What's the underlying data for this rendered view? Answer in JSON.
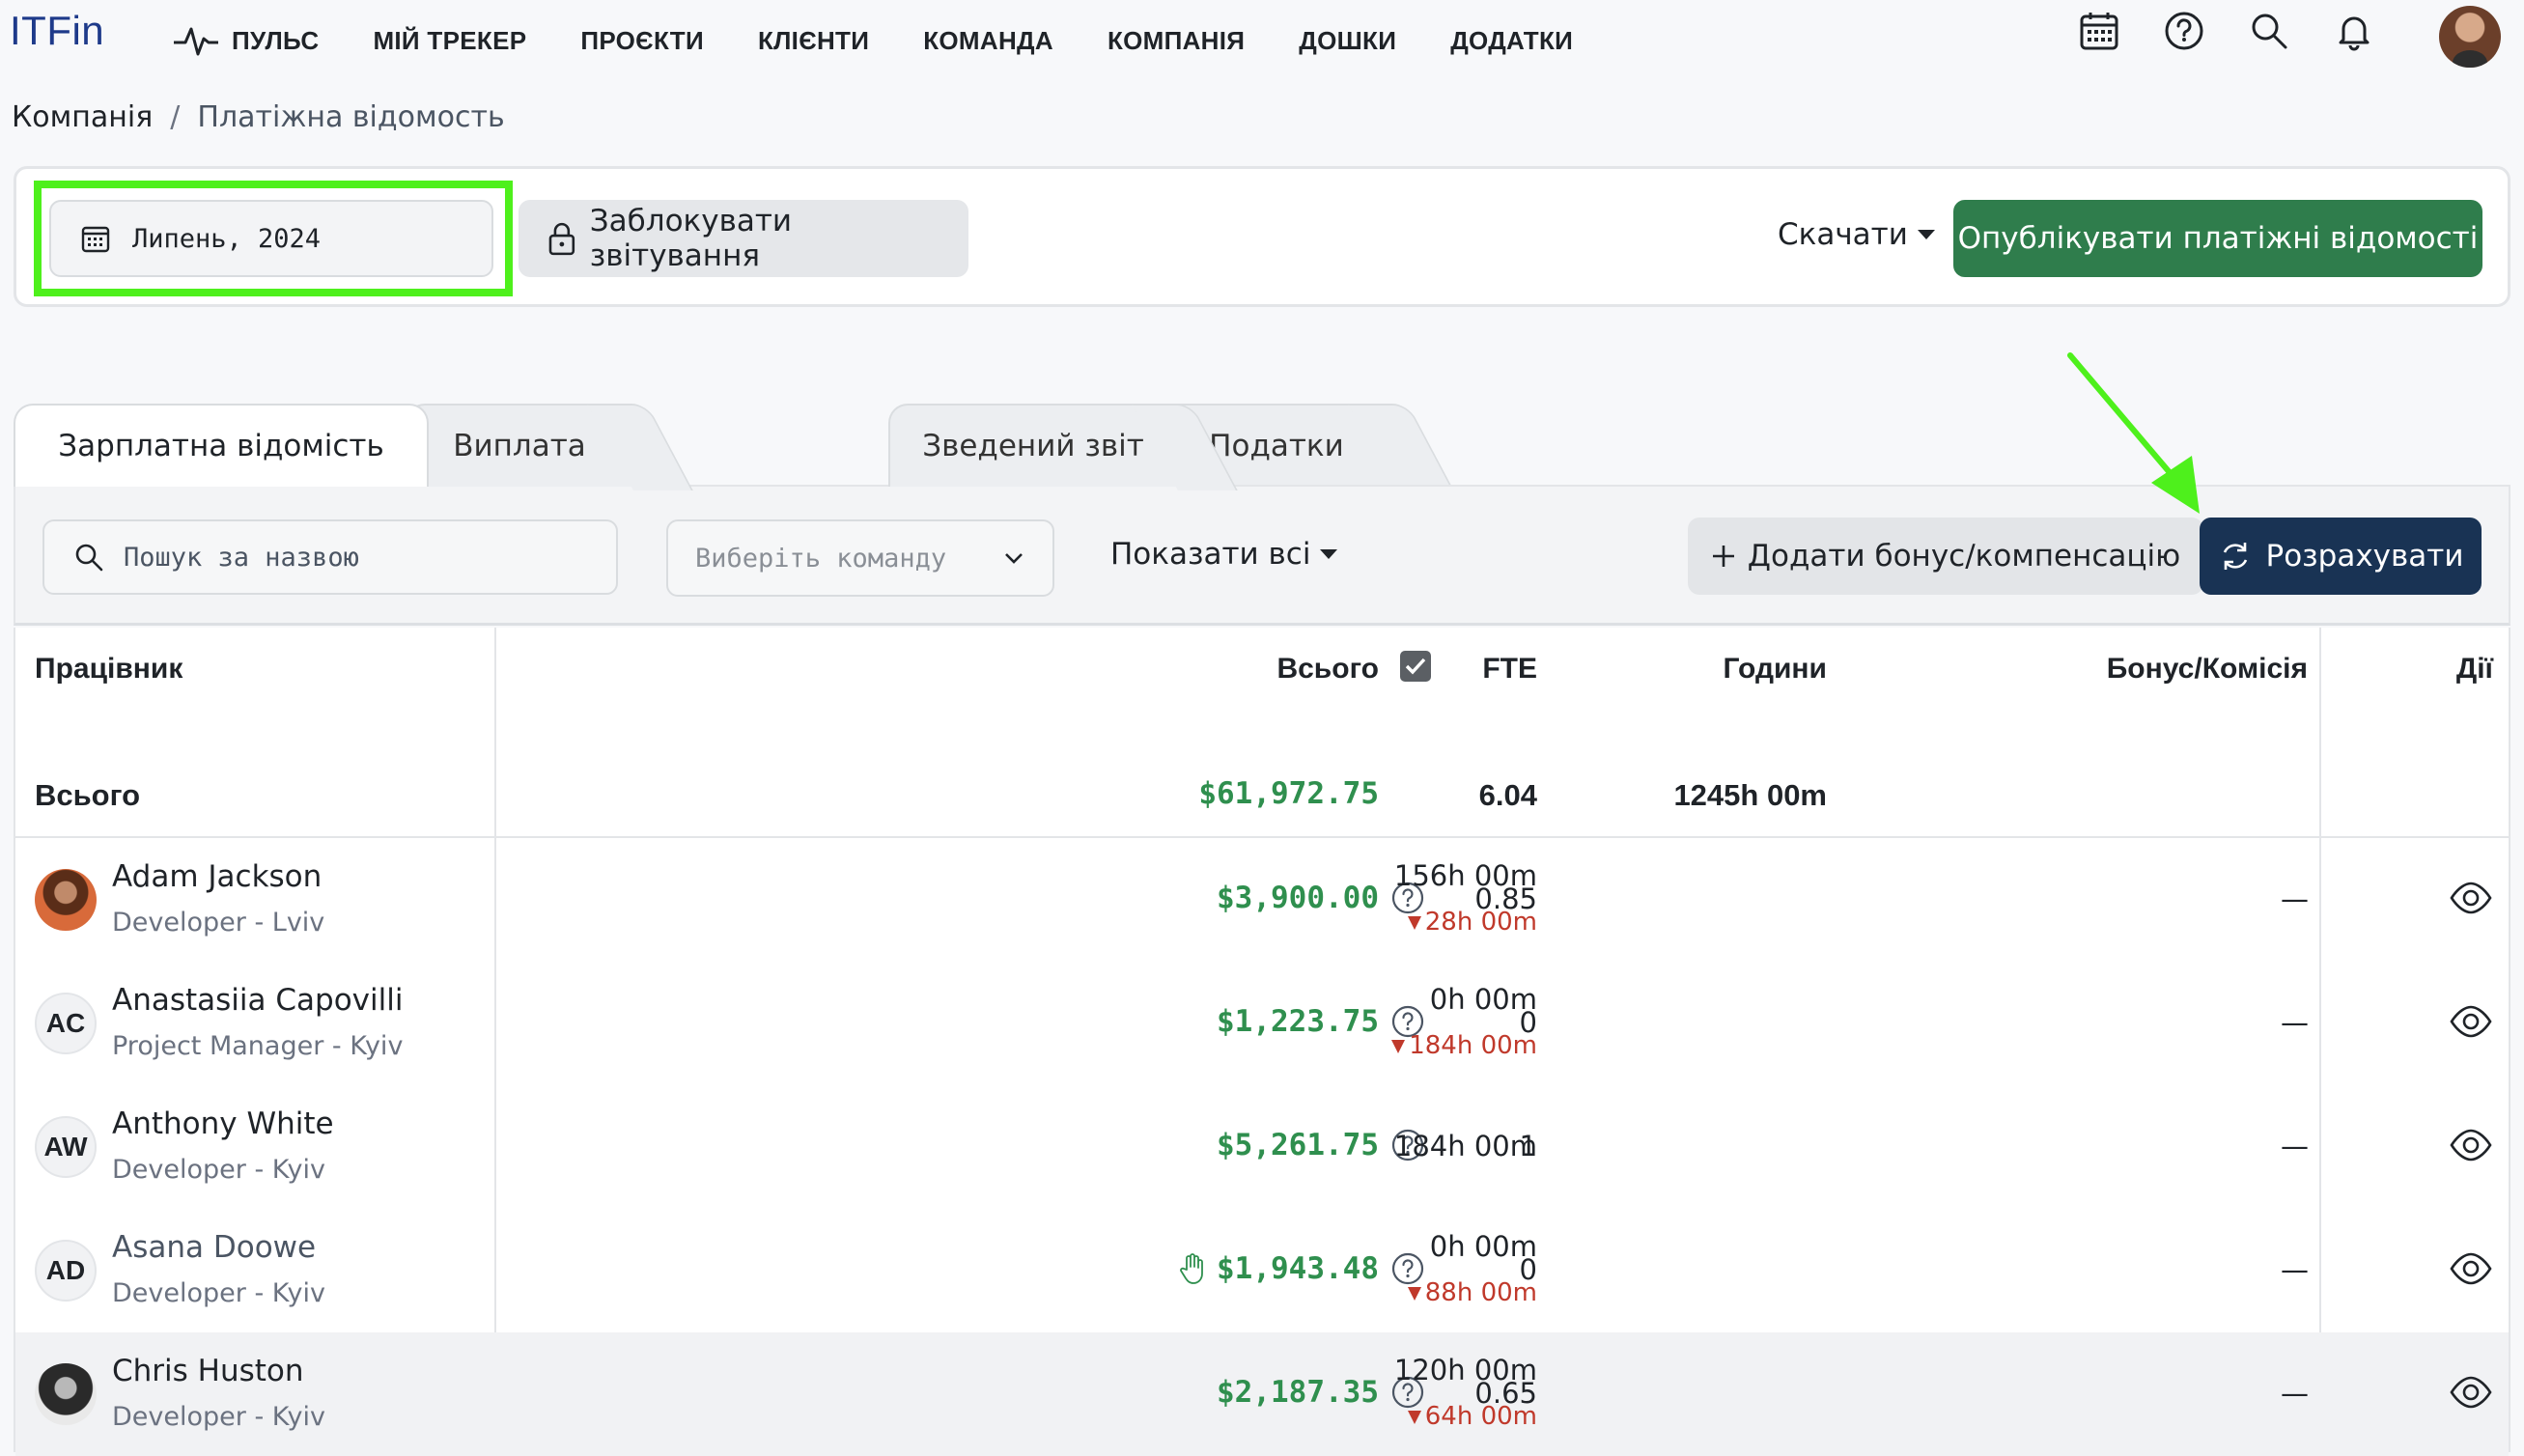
{
  "app": {
    "logo": "ITFin"
  },
  "nav": {
    "items": [
      {
        "label": "ПУЛЬС"
      },
      {
        "label": "МІЙ ТРЕКЕР"
      },
      {
        "label": "ПРОЄКТИ"
      },
      {
        "label": "КЛІЄНТИ"
      },
      {
        "label": "КОМАНДА"
      },
      {
        "label": "КОМПАНІЯ"
      },
      {
        "label": "ДОШКИ"
      },
      {
        "label": "ДОДАТКИ"
      }
    ],
    "icons": [
      "calendar-icon",
      "help-icon",
      "search-icon",
      "bell-icon",
      "user-avatar"
    ]
  },
  "breadcrumb": {
    "parent": "Компанія",
    "separator": "/",
    "current": "Платіжна відомость"
  },
  "toolbar": {
    "period": "Липень, 2024",
    "lock_label": "Заблокувати звітування",
    "download_label": "Скачати",
    "publish_label": "Опублікувати платіжні відомості"
  },
  "tabs": [
    {
      "label": "Зарплатна відомість",
      "active": true
    },
    {
      "label": "Виплата",
      "active": false
    },
    {
      "label": "Зведений звіт",
      "active": false
    },
    {
      "label": "Податки",
      "active": false
    }
  ],
  "filters": {
    "search_placeholder": "Пошук за назвою",
    "team_placeholder": "Виберіть команду",
    "show_all_label": "Показати всі",
    "add_bonus_label": "Додати бонус/компенсацію",
    "calculate_label": "Розрахувати"
  },
  "table": {
    "headers": {
      "employee": "Працівник",
      "total": "Всього",
      "fte": "FTE",
      "hours": "Години",
      "bonus": "Бонус/Комісія",
      "actions": "Дії"
    },
    "totals": {
      "label": "Всього",
      "total": "$61,972.75",
      "fte": "6.04",
      "hours": "1245h 00m"
    },
    "rows": [
      {
        "initials": "",
        "name": "Adam Jackson",
        "role": "Developer - Lviv",
        "total": "$3,900.00",
        "fte": "0.85",
        "hours": "156h 00m",
        "hours_delta": "28h 00m",
        "bonus": "—"
      },
      {
        "initials": "AC",
        "name": "Anastasiia Capovilli",
        "role": "Project Manager - Kyiv",
        "total": "$1,223.75",
        "fte": "0",
        "hours": "0h 00m",
        "hours_delta": "184h 00m",
        "bonus": "—"
      },
      {
        "initials": "AW",
        "name": "Anthony White",
        "role": "Developer - Kyiv",
        "total": "$5,261.75",
        "fte": "1",
        "hours": "184h 00m",
        "hours_delta": "",
        "bonus": "—"
      },
      {
        "initials": "AD",
        "name": "Asana Doowe",
        "role": "Developer - Kyiv",
        "total": "$1,943.48",
        "fte": "0",
        "hours": "0h 00m",
        "hours_delta": "88h 00m",
        "bonus": "—"
      },
      {
        "initials": "",
        "name": "Chris Huston",
        "role": "Developer - Kyiv",
        "total": "$2,187.35",
        "fte": "0.65",
        "hours": "120h 00m",
        "hours_delta": "64h 00m",
        "bonus": "—"
      }
    ]
  },
  "colors": {
    "accent_green": "#2f7d4c",
    "money_green": "#2f8f4e",
    "dark_button": "#193354",
    "highlight": "#4ef01c",
    "negative": "#c0392b"
  }
}
